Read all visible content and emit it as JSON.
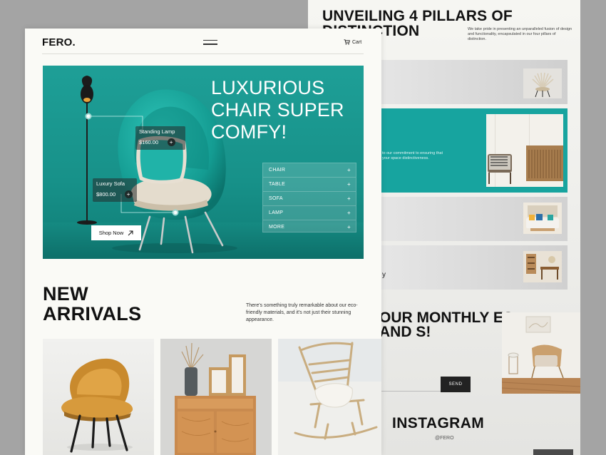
{
  "colors": {
    "accent": "#17a49f",
    "page_background": "#a4a4a4",
    "paper": "#fafaf6",
    "dark": "#222222"
  },
  "front": {
    "logo": "FERO.",
    "menu_icon": "hamburger-icon",
    "cart_label": "Cart",
    "cart_icon": "cart-icon",
    "hero": {
      "title": "LUXURIOUS CHAIR SUPER COMFY!",
      "tags": [
        {
          "name": "Standing Lamp",
          "price": "$160.00"
        },
        {
          "name": "Luxury Sofa",
          "price": "$800.00"
        }
      ],
      "categories": [
        {
          "label": "CHAIR"
        },
        {
          "label": "TABLE"
        },
        {
          "label": "SOFA"
        },
        {
          "label": "LAMP"
        },
        {
          "label": "MORE"
        }
      ],
      "shop_button": "Shop Now"
    },
    "arrivals": {
      "title": "NEW ARRIVALS",
      "description": "There's something truly remarkable about our eco-friendly materials, and it's not just their stunning appearance."
    }
  },
  "back": {
    "pillars_title": "UNVEILING 4 PILLARS OF DISTINCTION",
    "pillars_description": "We take pride in presenting an unparalleled fusion of design and functionality, encapsulated in our four pillars of distinction.",
    "pillar_2_text": "to our commitment to ensuring that your space distinctiveness.",
    "pillar_4_text": "y",
    "newsletter_title": "OUR MONTHLY ES AND S!",
    "send_button": "SEND",
    "instagram_title": "INSTAGRAM",
    "instagram_handle": "@FERO"
  }
}
